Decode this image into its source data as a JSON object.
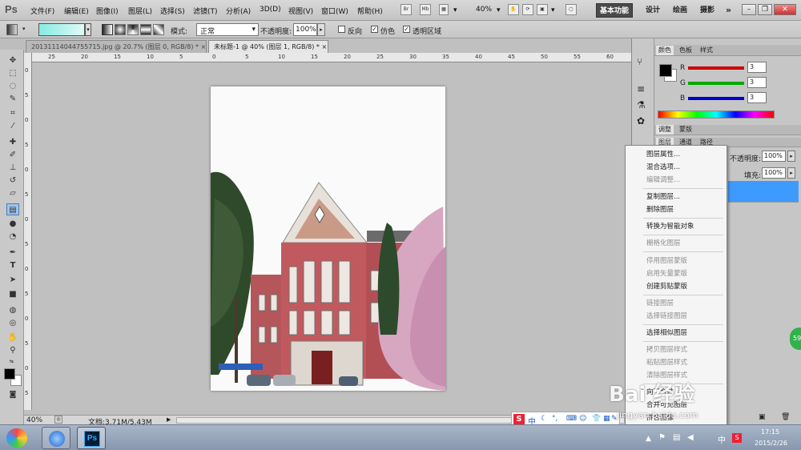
{
  "app": {
    "logo": "Ps"
  },
  "menu": [
    "文件(F)",
    "编辑(E)",
    "图像(I)",
    "图层(L)",
    "选择(S)",
    "滤镜(T)",
    "分析(A)",
    "3D(D)",
    "视图(V)",
    "窗口(W)",
    "帮助(H)"
  ],
  "menubar": {
    "br": "Br",
    "mb": "Mb",
    "zoom": "40%",
    "workspaces": [
      "基本功能",
      "设计",
      "绘画",
      "摄影"
    ],
    "more": "»"
  },
  "options": {
    "mode_label": "模式:",
    "mode_value": "正常",
    "opacity_label": "不透明度:",
    "opacity_value": "100%",
    "reverse": "反向",
    "dither": "仿色",
    "transparency": "透明区域"
  },
  "docs": {
    "tab1": "20131114044755715.jpg @ 20.7% (图层 0, RGB/8) *",
    "tab2": "未标题-1 @ 40% (图层 1, RGB/8) *",
    "tab_close": "×"
  },
  "ruler_top": [
    "25",
    "20",
    "15",
    "10",
    "5",
    "0",
    "5",
    "10",
    "15",
    "20",
    "25",
    "30",
    "35",
    "40",
    "45",
    "50",
    "55",
    "60"
  ],
  "ruler_left": [
    "0",
    "5",
    "0",
    "5",
    "0",
    "5",
    "0",
    "5",
    "0",
    "5",
    "0",
    "5",
    "0",
    "5"
  ],
  "status": {
    "zoom": "40%",
    "doc": "文档:3.71M/5.43M"
  },
  "color_panel": {
    "tabs": [
      "颜色",
      "色板",
      "样式"
    ],
    "r_label": "R",
    "g_label": "G",
    "b_label": "B",
    "r": "3",
    "g": "3",
    "b": "3",
    "colors": {
      "r": "#cc0000",
      "g": "#00aa00",
      "b": "#0000cc"
    }
  },
  "adjust_panel": {
    "tabs": [
      "调整",
      "蒙版"
    ]
  },
  "layers_panel": {
    "tabs": [
      "图层",
      "通道",
      "路径"
    ],
    "opacity_label": "不透明度:",
    "opacity_value": "100%",
    "fill_label": "填充:",
    "fill_value": "100%",
    "selected_color": "#3d9bff"
  },
  "context_menu": {
    "items": [
      {
        "label": "图层属性...",
        "disabled": false
      },
      {
        "label": "混合选项...",
        "disabled": false
      },
      {
        "label": "编辑调整...",
        "disabled": true
      },
      {
        "label": "复制图层...",
        "disabled": false
      },
      {
        "label": "删除图层",
        "disabled": false
      },
      {
        "label": "转换为智能对象",
        "disabled": false
      },
      {
        "label": "栅格化图层",
        "disabled": true
      },
      {
        "label": "停用图层蒙版",
        "disabled": true
      },
      {
        "label": "启用矢量蒙版",
        "disabled": true
      },
      {
        "label": "创建剪贴蒙版",
        "disabled": false
      },
      {
        "label": "链接图层",
        "disabled": true
      },
      {
        "label": "选择链接图层",
        "disabled": true
      },
      {
        "label": "选择相似图层",
        "disabled": false
      },
      {
        "label": "拷贝图层样式",
        "disabled": true
      },
      {
        "label": "粘贴图层样式",
        "disabled": true
      },
      {
        "label": "清除图层样式",
        "disabled": true
      },
      {
        "label": "向下合并",
        "disabled": false
      },
      {
        "label": "合并可见图层",
        "disabled": false
      },
      {
        "label": "拼合图像",
        "disabled": false
      }
    ]
  },
  "taskbar": {
    "ps_label": "Ps",
    "time": "17:15",
    "date": "2015/2/26"
  },
  "ime": {
    "label": "中"
  },
  "green_badge": "59",
  "watermark": {
    "brand": "Bai 经验",
    "url": "jingyan.baidu.com"
  }
}
